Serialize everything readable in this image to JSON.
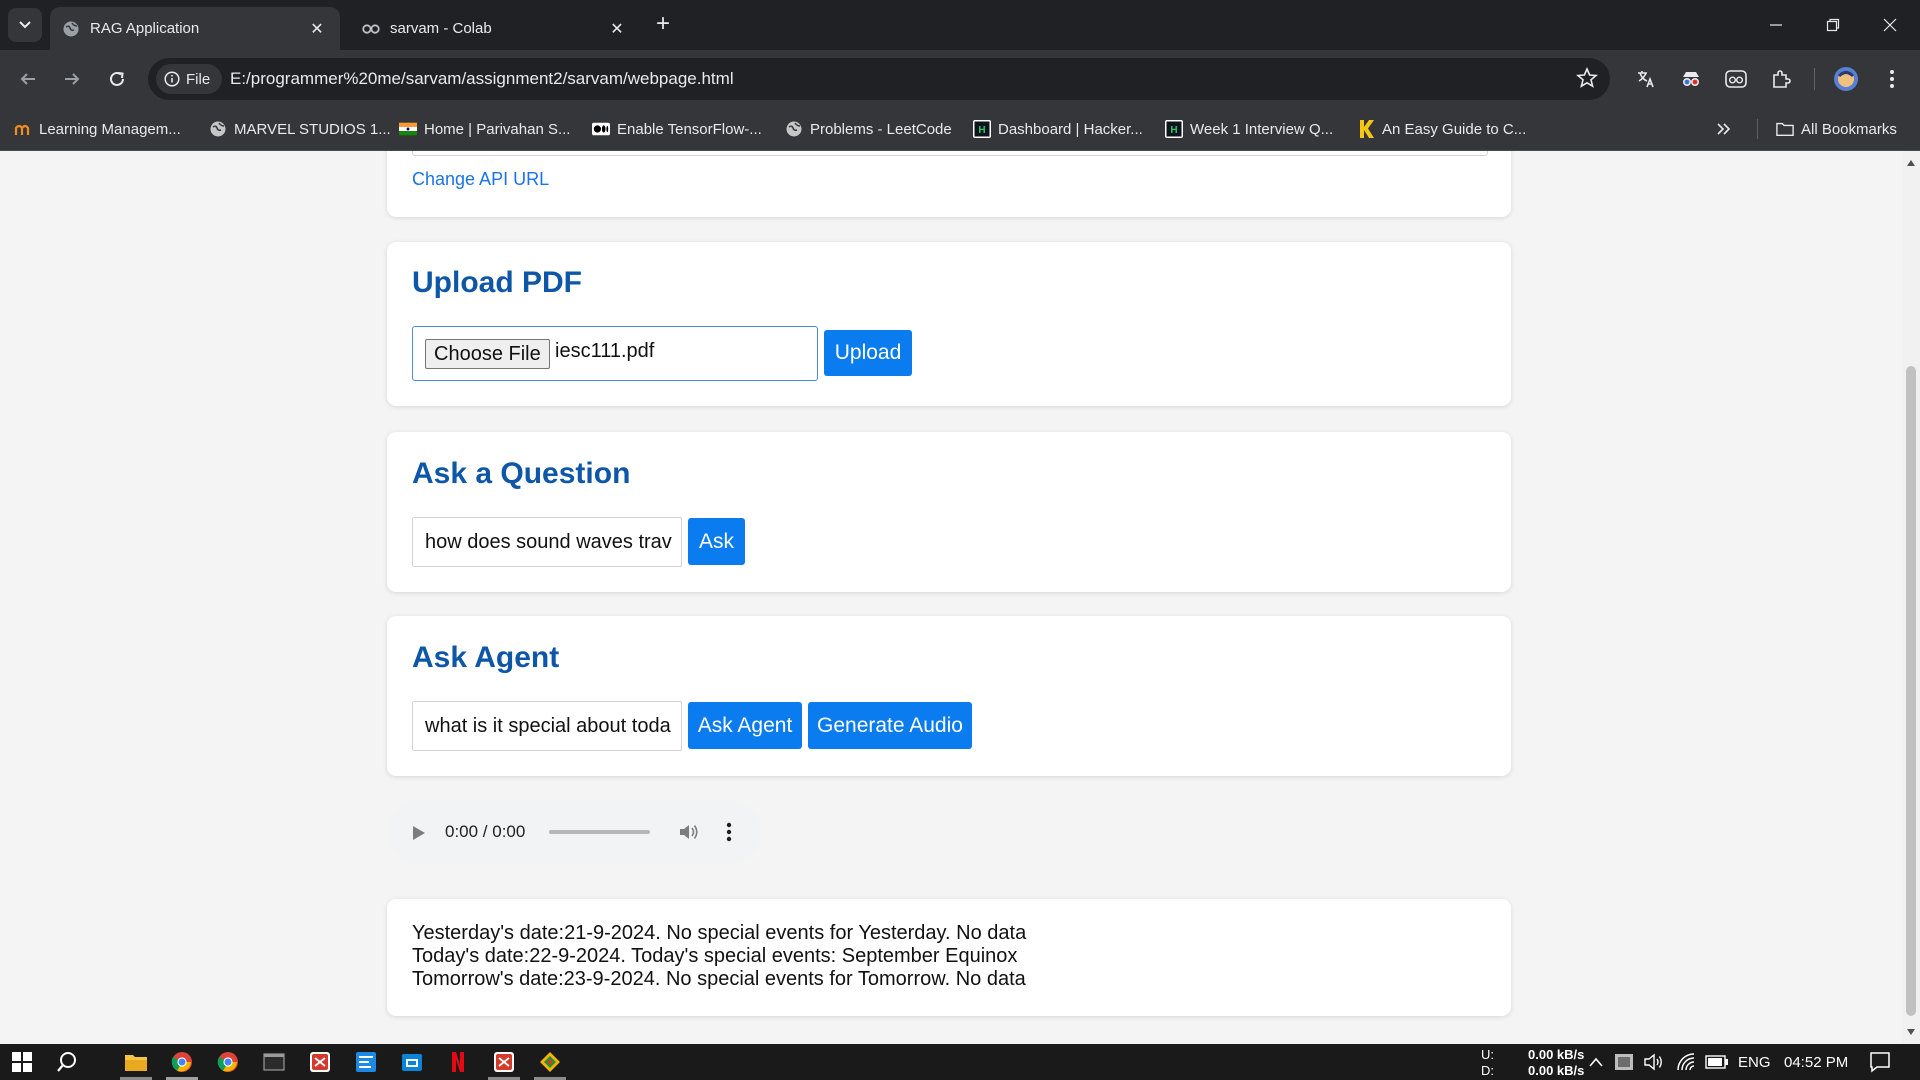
{
  "browser": {
    "tabs": [
      {
        "title": "RAG Application",
        "active": true
      },
      {
        "title": "sarvam - Colab",
        "active": false
      }
    ],
    "site_info_label": "File",
    "url": "E:/programmer%20me/sarvam/assignment2/sarvam/webpage.html",
    "bookmarks": [
      {
        "label": "Learning Managem...",
        "icon": "learning-icon"
      },
      {
        "label": "MARVEL STUDIOS 1...",
        "icon": "globe-icon"
      },
      {
        "label": "Home | Parivahan S...",
        "icon": "india-flag-icon"
      },
      {
        "label": "Enable TensorFlow-...",
        "icon": "medium-icon"
      },
      {
        "label": "Problems - LeetCode",
        "icon": "globe-icon"
      },
      {
        "label": "Dashboard | Hacker...",
        "icon": "hackerrank-icon"
      },
      {
        "label": "Week 1 Interview Q...",
        "icon": "hackerrank-icon"
      },
      {
        "label": "An Easy Guide to C...",
        "icon": "k-icon"
      }
    ],
    "all_bookmarks_label": "All Bookmarks"
  },
  "page": {
    "api_section": {
      "change_api_link": "Change API URL"
    },
    "upload_section": {
      "title": "Upload PDF",
      "choose_file_label": "Choose File",
      "file_name": "iesc111.pdf",
      "upload_button": "Upload"
    },
    "question_section": {
      "title": "Ask a Question",
      "input_value": "how does sound waves trav",
      "ask_button": "Ask"
    },
    "agent_section": {
      "title": "Ask Agent",
      "input_value": "what is it special about toda",
      "ask_agent_button": "Ask Agent",
      "generate_audio_button": "Generate Audio"
    },
    "audio_player": {
      "time": "0:00 / 0:00"
    },
    "result": {
      "lines": [
        "Yesterday's date:21-9-2024. No special events for Yesterday. No data",
        "Today's date:22-9-2024. Today's special events: September Equinox",
        "Tomorrow's date:23-9-2024. No special events for Tomorrow. No data"
      ]
    }
  },
  "taskbar": {
    "net_up_label": "U:",
    "net_down_label": "D:",
    "net_up_value": "0.00 kB/s",
    "net_down_value": "0.00 kB/s",
    "language": "ENG",
    "time": "04:52 PM"
  },
  "colors": {
    "heading": "#0e56a8",
    "button": "#0a7cf0",
    "link": "#1a73e8",
    "chrome_dark": "#202124",
    "chrome_toolbar": "#35363a"
  }
}
